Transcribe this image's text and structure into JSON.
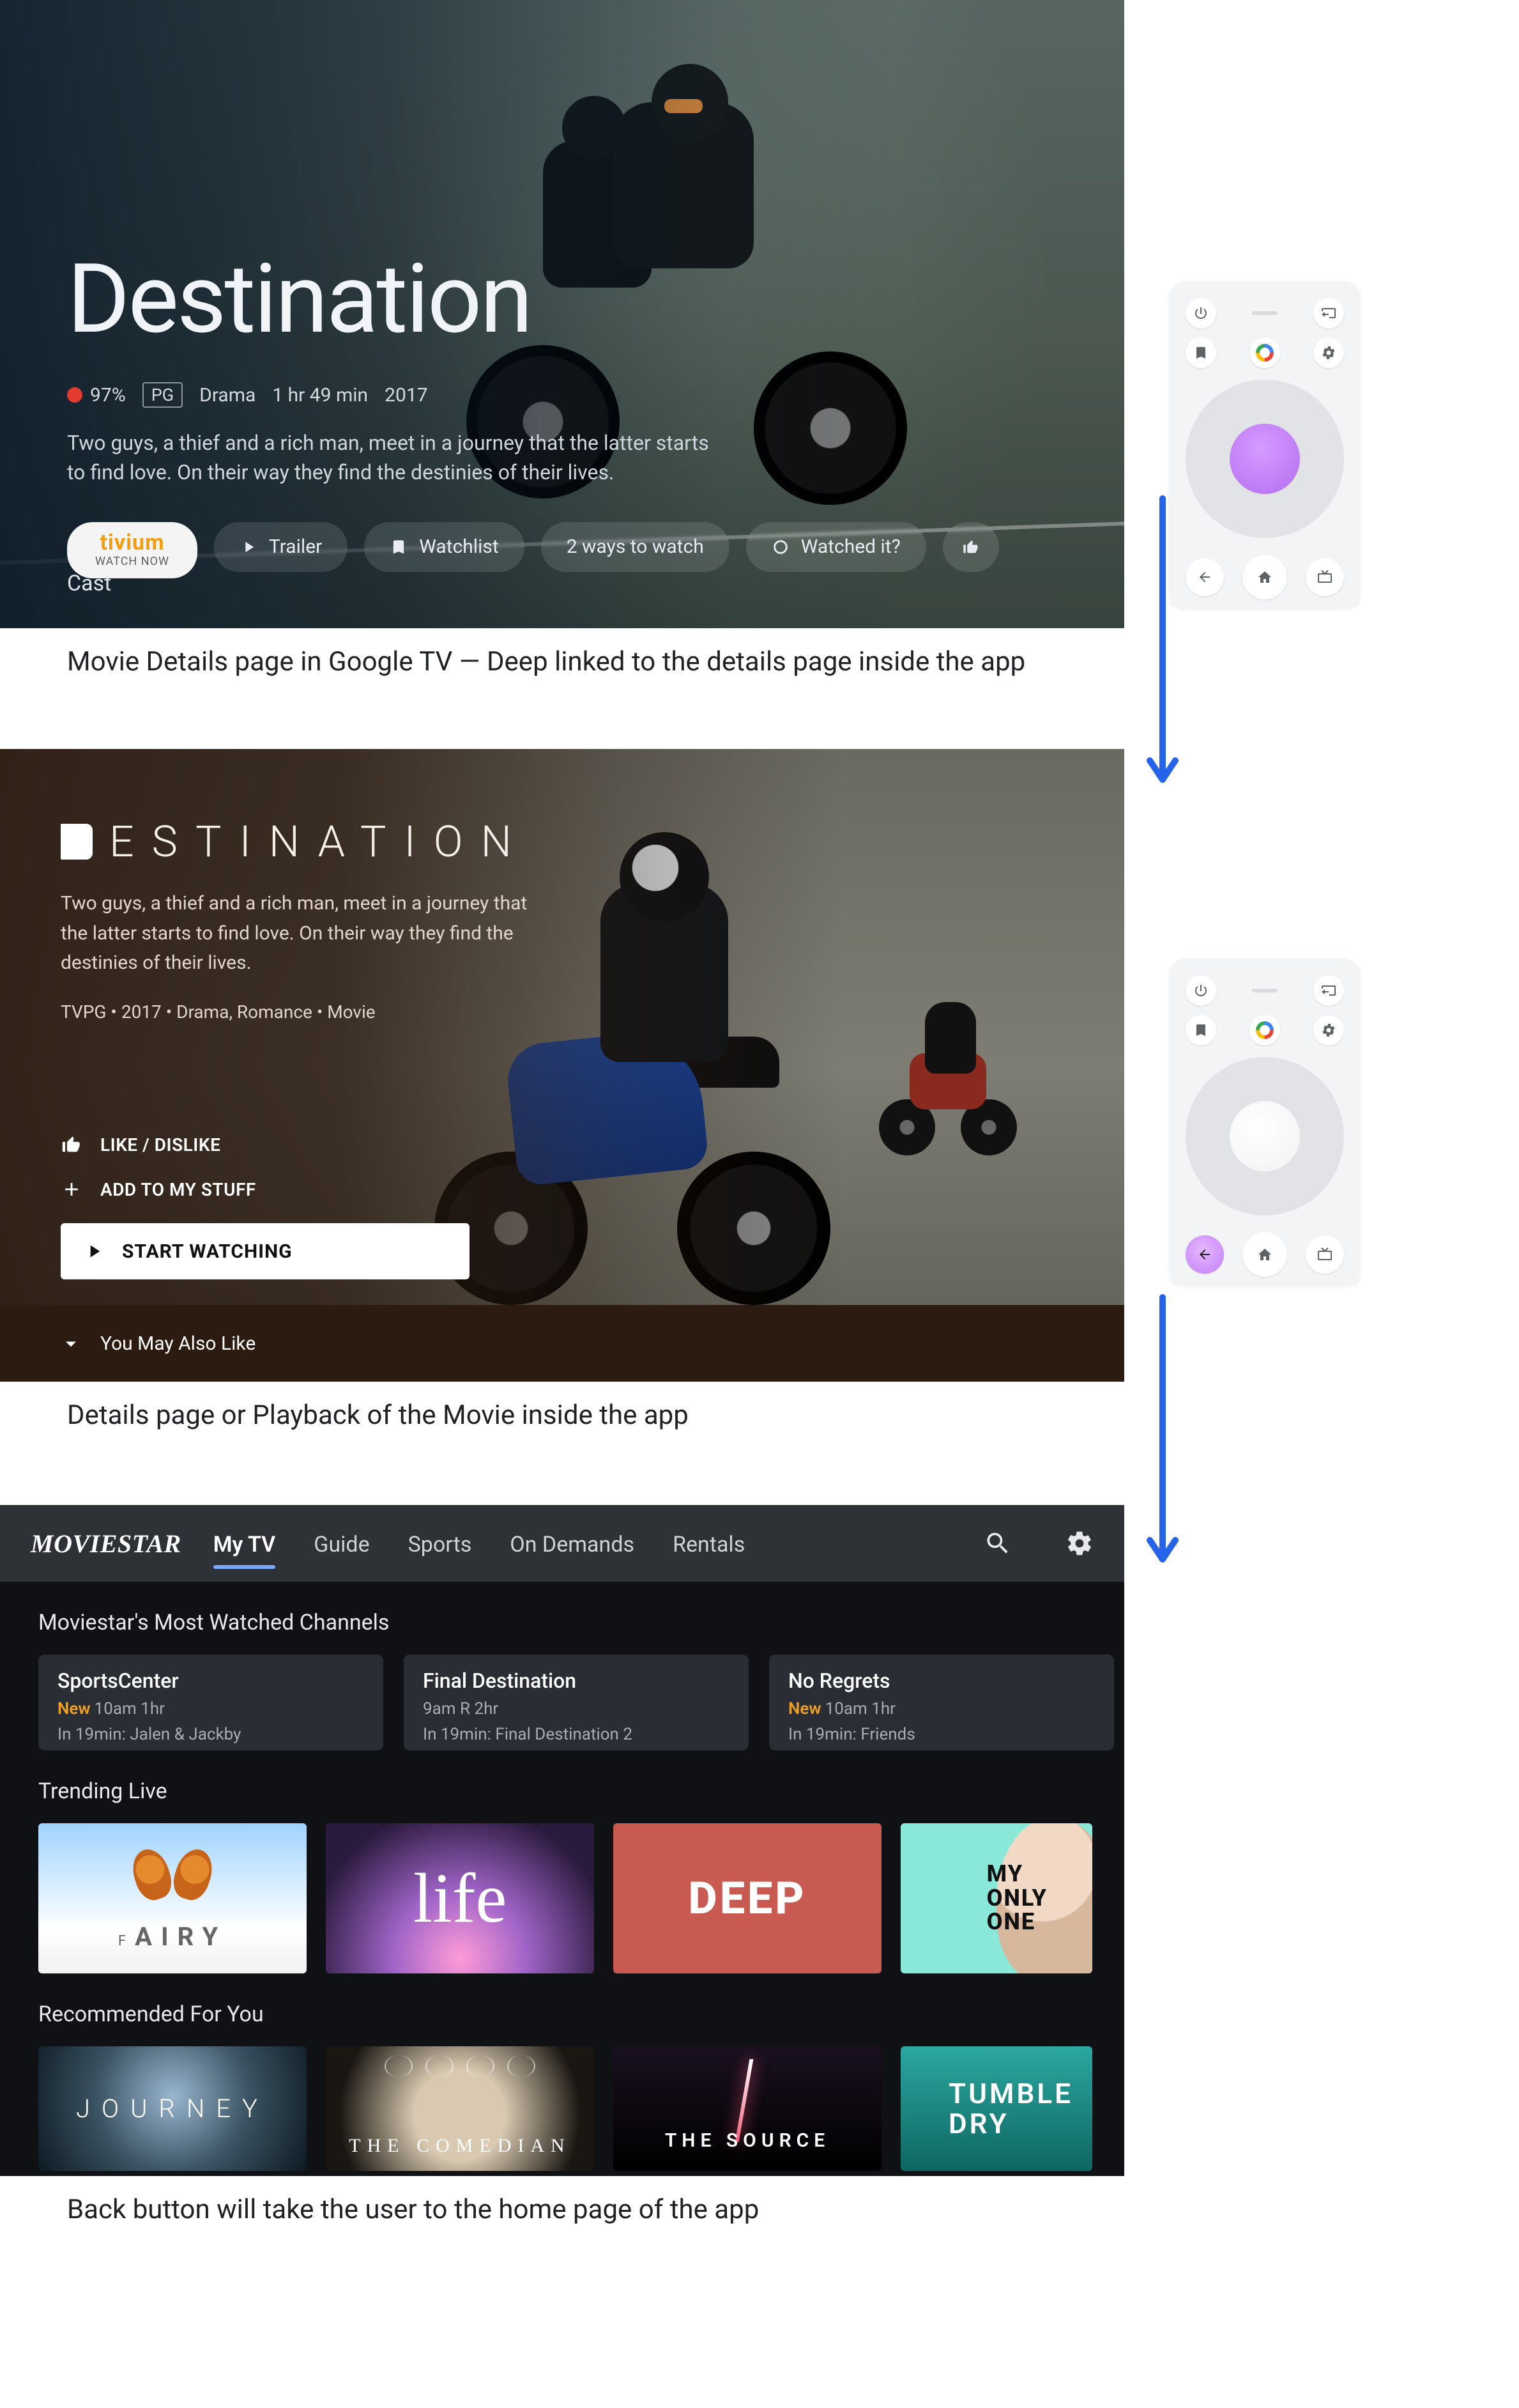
{
  "screen1": {
    "title": "Destination",
    "tomato_pct": "97%",
    "rating_chip": "PG",
    "genre": "Drama",
    "runtime": "1 hr 49 min",
    "year": "2017",
    "description": "Two guys, a thief and a rich man, meet in a journey that the latter starts to find love. On their way they find the destinies of their lives.",
    "watch_now": {
      "brand": "tivium",
      "sub": "WATCH NOW"
    },
    "buttons": {
      "trailer": "Trailer",
      "watchlist": "Watchlist",
      "ways": "2 ways to watch",
      "watched": "Watched it?"
    },
    "cast_label": "Cast"
  },
  "caption1": "Movie Details page in Google TV — Deep linked to the details page inside the app",
  "screen2": {
    "title_rest": "ESTINATION",
    "description": "Two guys, a thief and a rich man, meet in a journey that the latter starts to find love. On their way they find the destinies of their lives.",
    "meta": "TVPG • 2017 • Drama, Romance • Movie",
    "like": "LIKE / DISLIKE",
    "add": "ADD TO MY STUFF",
    "start": "START WATCHING",
    "ymal": "You May Also Like"
  },
  "caption2": "Details page or Playback of the Movie inside the app",
  "screen3": {
    "brand": "MOVIESTAR",
    "tabs": [
      "My TV",
      "Guide",
      "Sports",
      "On Demands",
      "Rentals"
    ],
    "active_tab_index": 0,
    "section_most": "Moviestar's Most Watched Channels",
    "channel_cards": [
      {
        "title": "SportsCenter",
        "new": true,
        "time": "10am 1hr",
        "next": "In 19min: Jalen & Jackby"
      },
      {
        "title": "Final Destination",
        "new": false,
        "time": "9am R 2hr",
        "next": "In 19min: Final Destination 2"
      },
      {
        "title": "No Regrets",
        "new": true,
        "time": "10am 1hr",
        "next": "In 19min: Friends"
      }
    ],
    "section_trending": "Trending Live",
    "trending": [
      {
        "label_pre": "F",
        "label_main": "AIRY"
      },
      {
        "label": "life"
      },
      {
        "label": "DEEP"
      },
      {
        "label": "MY\nONLY\nONE"
      }
    ],
    "section_rec": "Recommended For You",
    "recommended": [
      {
        "label": "JOURNEY"
      },
      {
        "label": "THE COMEDIAN"
      },
      {
        "label": "THE SOURCE"
      },
      {
        "label": "TUMBLE\nDRY"
      }
    ]
  },
  "caption3": "Back button will take the user to the home page of the app",
  "remote": {
    "buttons": {
      "power": "power-icon",
      "input": "input-icon",
      "bookmark": "bookmark-icon",
      "assistant": "assistant-icon",
      "settings": "gear-icon",
      "back": "back-icon",
      "home": "home-icon",
      "tv": "tv-icon"
    }
  }
}
